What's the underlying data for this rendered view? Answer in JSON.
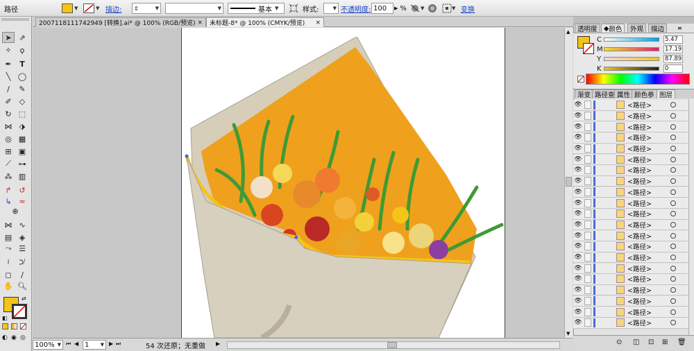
{
  "control_bar": {
    "object_type": "路径",
    "stroke_label": "描边:",
    "stroke_profile": "基本",
    "style_label": "样式:",
    "opacity_label": "不透明度:",
    "opacity_value": "100",
    "opacity_unit": "%",
    "transform_label": "变换",
    "fill_color": "#f5c418"
  },
  "tabs": [
    {
      "label": "2007118111742949 [转换].ai* @ 100% (RGB/预览)",
      "active": false
    },
    {
      "label": "未标题-8* @ 100% (CMYK/预览)",
      "active": true
    }
  ],
  "status_bar": {
    "zoom": "100%",
    "page": "1",
    "undo_text": "54 次还原；无重做"
  },
  "color_panel": {
    "tabs": [
      "透明度",
      "颜色",
      "外观",
      "描边"
    ],
    "active_tab": "颜色",
    "channels": [
      {
        "name": "C",
        "value": "5.47"
      },
      {
        "name": "M",
        "value": "17.19"
      },
      {
        "name": "Y",
        "value": "87.89"
      },
      {
        "name": "K",
        "value": "0"
      }
    ],
    "fill_color": "#f5c418"
  },
  "layers_panel": {
    "tabs": [
      "渐变",
      "路径查",
      "属性",
      "颜色参",
      "图层"
    ],
    "active_tab": "图层",
    "rows": [
      "<路径>",
      "<路径>",
      "<路径>",
      "<路径>",
      "<路径>",
      "<路径>",
      "<路径>",
      "<路径>",
      "<路径>",
      "<路径>",
      "<路径>",
      "<路径>",
      "<路径>",
      "<路径>",
      "<路径>",
      "<路径>",
      "<路径>",
      "<路径>",
      "<路径>",
      "<路径>",
      "<路径>"
    ]
  },
  "colors": {
    "accent": "#f5c418",
    "link": "#1a44c8",
    "panel_bg": "#e2e2e2",
    "wrap_paper": "#d8d0bf",
    "bouquet_orange": "#f0a21e"
  }
}
